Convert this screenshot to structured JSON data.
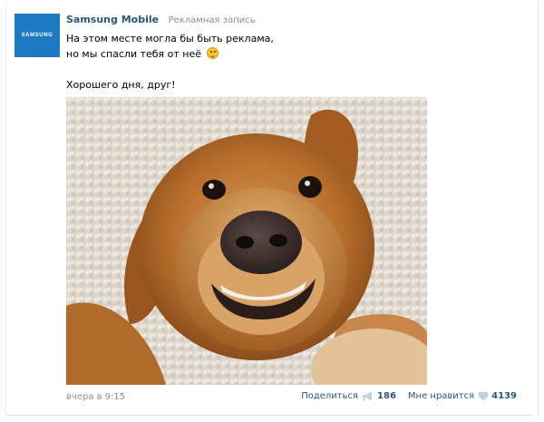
{
  "post": {
    "avatar_text": "SAMSUNG",
    "author": "Samsung Mobile",
    "ad_label": "Рекламная запись",
    "text_line1": "На этом месте могла бы быть реклама,",
    "text_line2": "но мы спасли тебя от неё",
    "text_line3": "Хорошего дня, друг!",
    "emoji": "wink-smile-icon",
    "photo_alt": "photo",
    "time": "вчера в 9:15",
    "share_label": "Поделиться",
    "share_count": "186",
    "like_label": "Мне нравится",
    "like_count": "4139"
  },
  "colors": {
    "brand": "#1e79c3",
    "link": "#2b587a",
    "muted": "#8f8f8f",
    "icon": "#c3cfdb"
  }
}
